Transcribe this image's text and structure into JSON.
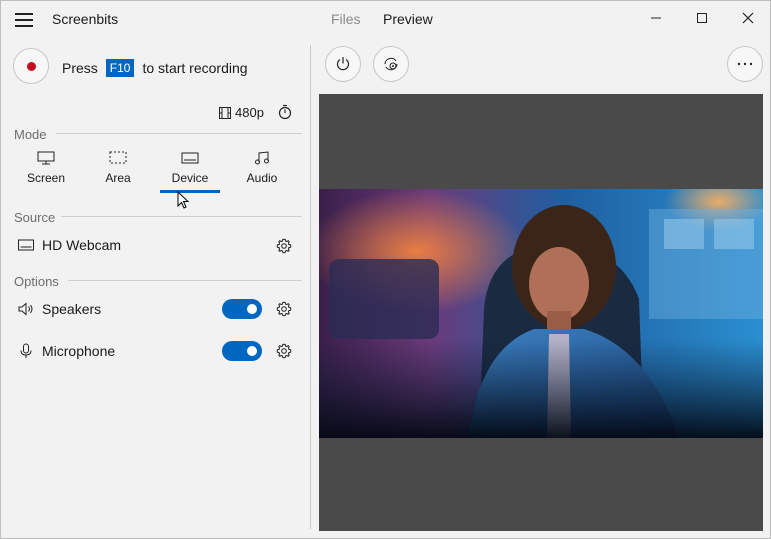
{
  "app": {
    "title": "Screenbits"
  },
  "tabs": {
    "files": "Files",
    "preview": "Preview"
  },
  "record": {
    "press": "Press",
    "key": "F10",
    "suffix": "to start recording"
  },
  "quality": {
    "label": "480p"
  },
  "mode": {
    "section": "Mode",
    "items": [
      {
        "label": "Screen",
        "icon": "monitor-icon"
      },
      {
        "label": "Area",
        "icon": "area-select-icon"
      },
      {
        "label": "Device",
        "icon": "device-icon",
        "selected": true
      },
      {
        "label": "Audio",
        "icon": "music-note-icon"
      }
    ]
  },
  "source": {
    "section": "Source",
    "device": "HD Webcam"
  },
  "options": {
    "section": "Options",
    "speakers": {
      "label": "Speakers",
      "enabled": true
    },
    "microphone": {
      "label": "Microphone",
      "enabled": true
    }
  },
  "colors": {
    "accent": "#0067c0",
    "record": "#c50f1f"
  }
}
